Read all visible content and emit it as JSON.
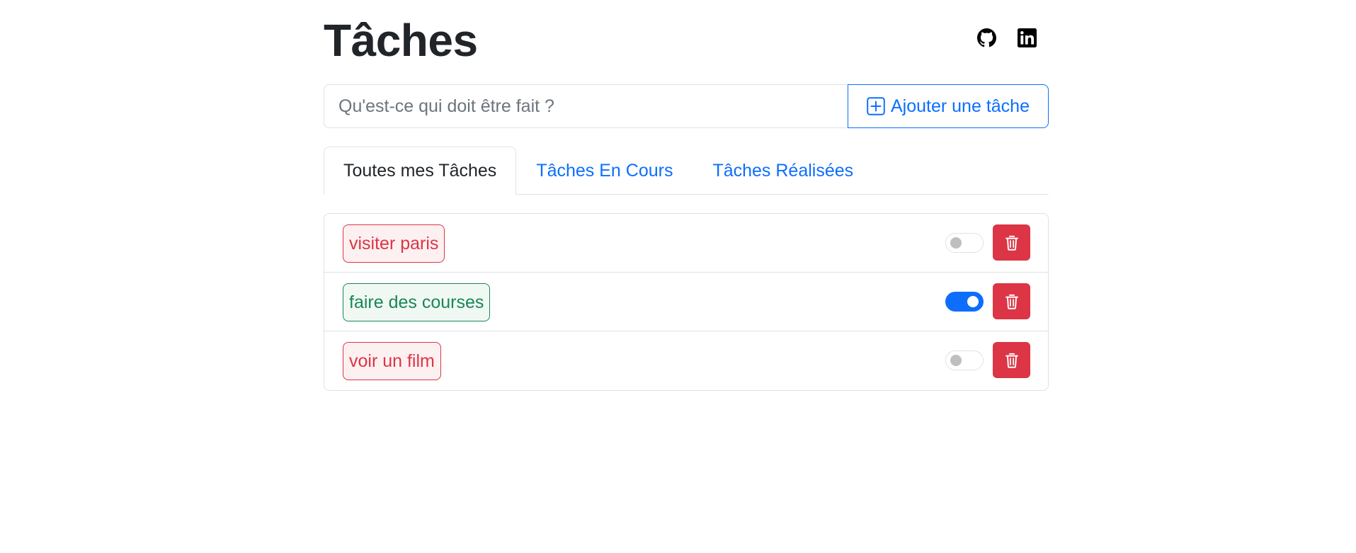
{
  "header": {
    "title": "Tâches",
    "links": [
      {
        "icon": "github-icon"
      },
      {
        "icon": "linkedin-icon"
      }
    ]
  },
  "add_task": {
    "value": "",
    "placeholder": "Qu'est-ce qui doit être fait ?",
    "button_icon": "plus-square-icon",
    "button_label": "Ajouter une tâche"
  },
  "tabs": [
    {
      "label": "Toutes mes Tâches",
      "active": true
    },
    {
      "label": "Tâches En Cours",
      "active": false
    },
    {
      "label": "Tâches Réalisées",
      "active": false
    }
  ],
  "tasks": [
    {
      "label": "visiter paris",
      "done": false,
      "delete_icon": "trash-icon"
    },
    {
      "label": "faire des courses",
      "done": true,
      "delete_icon": "trash-icon"
    },
    {
      "label": "voir un film",
      "done": false,
      "delete_icon": "trash-icon"
    }
  ],
  "colors": {
    "primary": "#0d6efd",
    "danger": "#dc3545",
    "success": "#198754",
    "border": "#dee2e6"
  }
}
